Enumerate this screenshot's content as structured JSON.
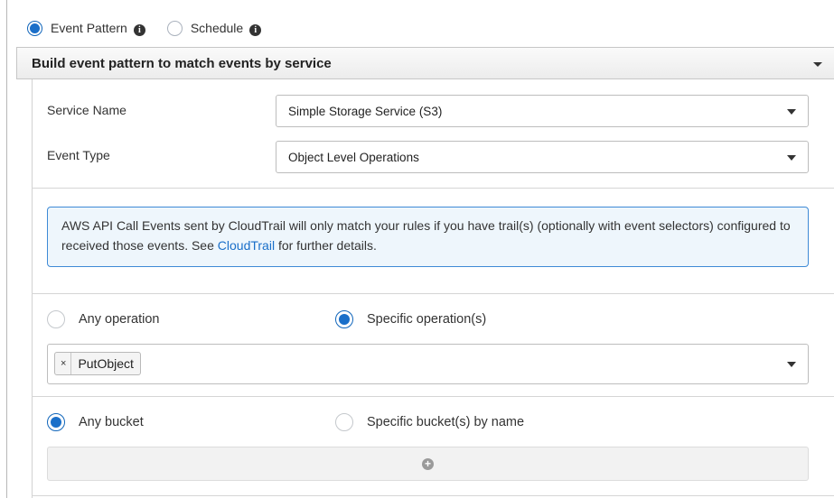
{
  "source": {
    "options": [
      {
        "label": "Event Pattern",
        "selected": true
      },
      {
        "label": "Schedule",
        "selected": false
      }
    ]
  },
  "section": {
    "title": "Build event pattern to match events by service"
  },
  "fields": {
    "service_name": {
      "label": "Service Name",
      "value": "Simple Storage Service (S3)"
    },
    "event_type": {
      "label": "Event Type",
      "value": "Object Level Operations"
    }
  },
  "info": {
    "text_before": "AWS API Call Events sent by CloudTrail will only match your rules if you have trail(s) (optionally with event selectors) configured to received those events. See ",
    "link": "CloudTrail",
    "text_after": " for further details."
  },
  "operation": {
    "any_label": "Any operation",
    "specific_label": "Specific operation(s)",
    "selected": "specific",
    "tokens": [
      "PutObject"
    ],
    "token_remove": "×"
  },
  "bucket": {
    "any_label": "Any bucket",
    "specific_label": "Specific bucket(s) by name",
    "selected": "any"
  },
  "colors": {
    "accent": "#1a6fc9",
    "info_bg": "#eef6fc",
    "info_border": "#3e8ad6"
  },
  "icons": {
    "info": "info-circle-icon",
    "add": "plus-circle-icon",
    "dropdown": "caret-down-icon"
  }
}
